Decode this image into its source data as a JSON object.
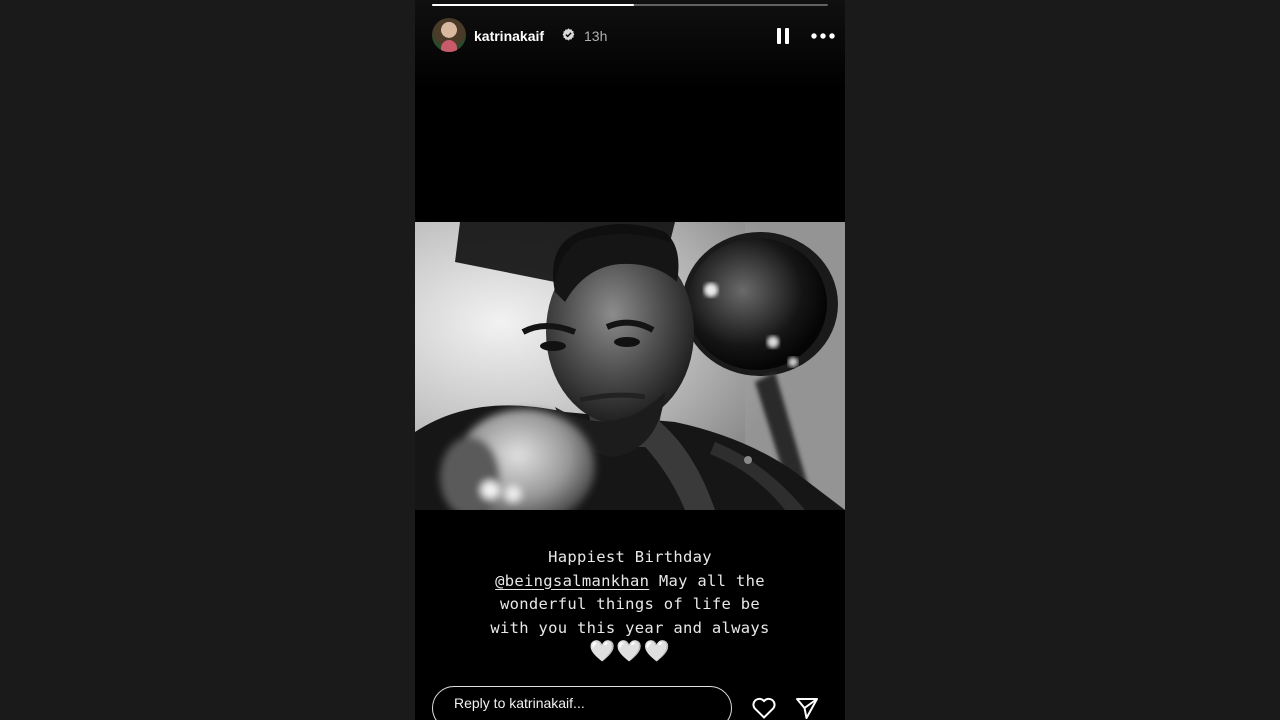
{
  "story": {
    "progress_fraction": 0.51,
    "author": {
      "username": "katrinakaif",
      "verified": true,
      "posted_ago": "13h",
      "avatar_icon": "profile-photo"
    },
    "controls": {
      "pause_icon": "pause-icon",
      "more_icon": "more-options-icon"
    },
    "media": {
      "kind": "black-and-white portrait photo"
    },
    "caption": {
      "line1": "Happiest Birthday",
      "mention": "@beingsalmankhan",
      "line2_rest": " May all the",
      "line3": "wonderful things of life be",
      "line4": "with you this year and always",
      "emoji": "🤍🤍🤍"
    },
    "reply": {
      "placeholder": "Reply to katrinakaif..."
    },
    "actions": {
      "like_icon": "heart-icon",
      "share_icon": "send-icon"
    }
  },
  "colors": {
    "page_background": "#1a1a1a",
    "story_background": "#000000",
    "text": "#ffffff",
    "muted": "#b0b0b0"
  }
}
